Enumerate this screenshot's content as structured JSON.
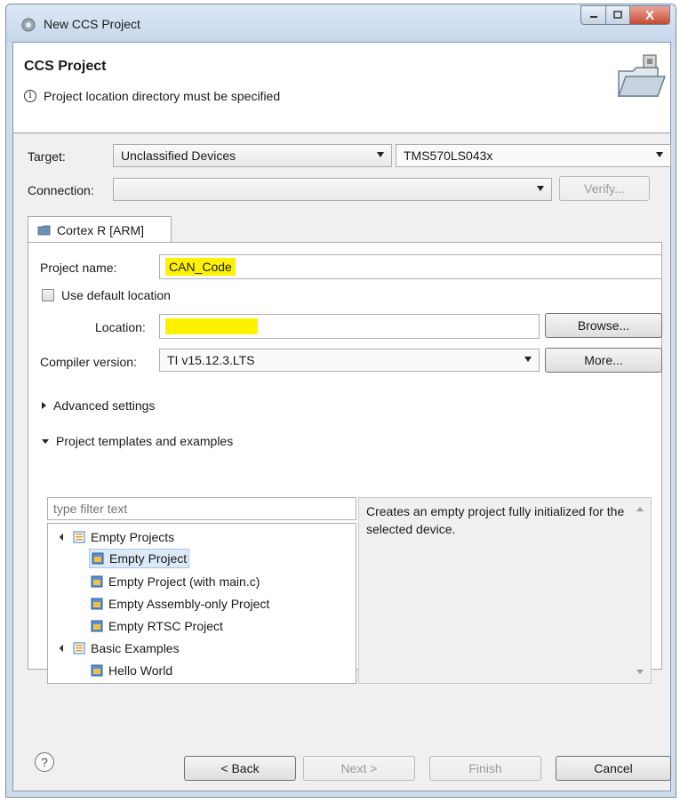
{
  "window": {
    "title": "New CCS Project"
  },
  "header": {
    "title": "CCS Project",
    "message": "Project location directory must be specified"
  },
  "target": {
    "label": "Target:",
    "family_value": "Unclassified Devices",
    "device_value": "TMS570LS043x"
  },
  "connection": {
    "label": "Connection:",
    "value": "",
    "verify_label": "Verify..."
  },
  "tab": {
    "label": "Cortex R [ARM]"
  },
  "project": {
    "name_label": "Project name:",
    "name_value": "CAN_Code",
    "default_location_label": "Use default location",
    "default_location_checked": false,
    "location_label": "Location:",
    "location_value": "",
    "browse_label": "Browse...",
    "compiler_label": "Compiler version:",
    "compiler_value": "TI v15.12.3.LTS",
    "more_label": "More..."
  },
  "sections": {
    "advanced_label": "Advanced settings",
    "templates_label": "Project templates and examples"
  },
  "templates": {
    "filter_placeholder": "type filter text",
    "tree": [
      {
        "label": "Empty Projects",
        "group": true
      },
      {
        "label": "Empty Project",
        "selected": true
      },
      {
        "label": "Empty Project (with main.c)"
      },
      {
        "label": "Empty Assembly-only Project"
      },
      {
        "label": "Empty RTSC Project"
      },
      {
        "label": "Basic Examples",
        "group": true
      },
      {
        "label": "Hello World"
      }
    ],
    "description": "Creates an empty project fully initialized for the selected device."
  },
  "footer": {
    "help_glyph": "?",
    "back_label": "< Back",
    "next_label": "Next >",
    "finish_label": "Finish",
    "cancel_label": "Cancel"
  },
  "colors": {
    "highlight": "#fff200",
    "selection": "#dce9f7",
    "close_button": "#c64a33"
  }
}
